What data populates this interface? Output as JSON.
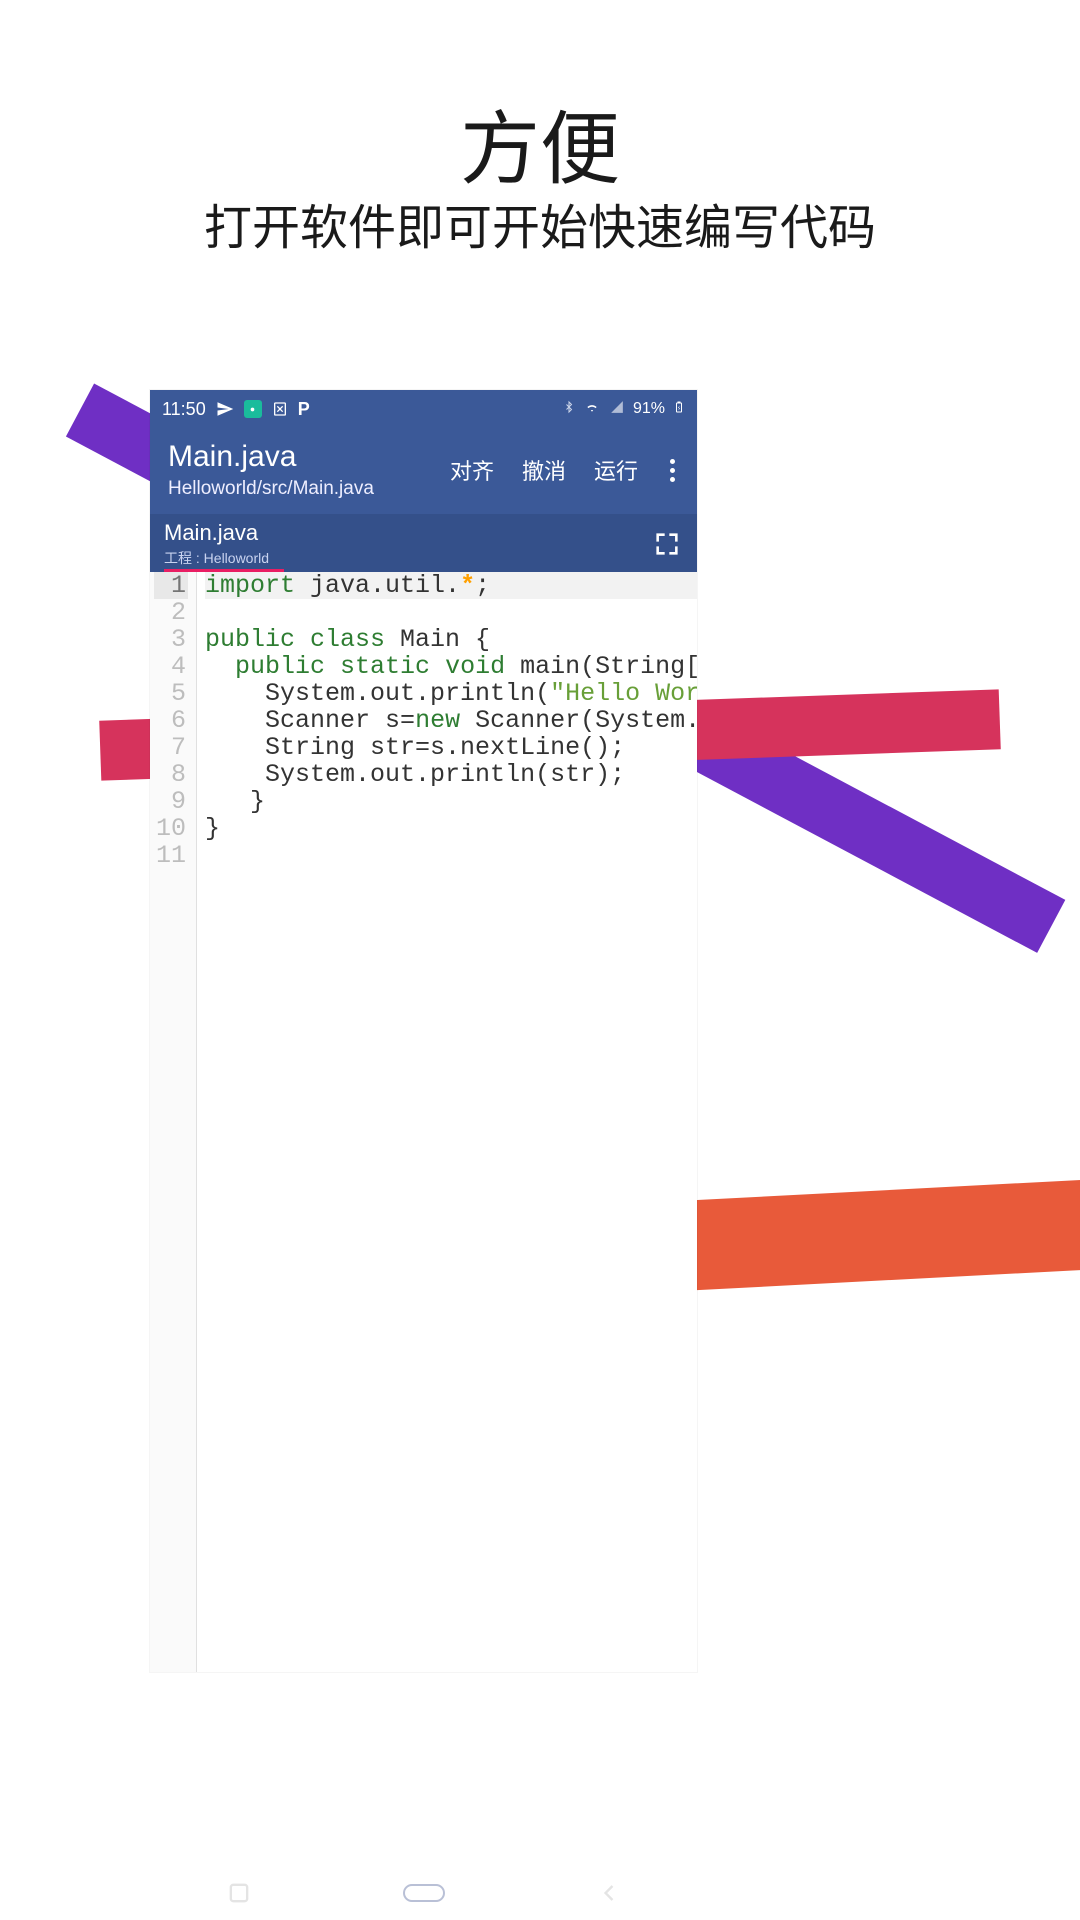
{
  "promo": {
    "headline": "方便",
    "subheadline": "打开软件即可开始快速编写代码"
  },
  "statusbar": {
    "time": "11:50",
    "battery": "91%"
  },
  "appbar": {
    "title": "Main.java",
    "subtitle": "Helloworld/src/Main.java",
    "actions": {
      "align": "对齐",
      "undo": "撤消",
      "run": "运行"
    }
  },
  "tab": {
    "name": "Main.java",
    "project_label": "工程",
    "project_name": "Helloworld"
  },
  "editor": {
    "lines": [
      {
        "n": 1,
        "tokens": [
          [
            "kw",
            "import"
          ],
          [
            "",
            " java.util."
          ],
          [
            "star",
            "*"
          ],
          [
            "",
            ";"
          ]
        ],
        "current": true
      },
      {
        "n": 2,
        "tokens": [
          [
            "",
            ""
          ]
        ]
      },
      {
        "n": 3,
        "tokens": [
          [
            "kw",
            "public class"
          ],
          [
            "",
            " Main {"
          ]
        ]
      },
      {
        "n": 4,
        "tokens": [
          [
            "",
            "  "
          ],
          [
            "kw",
            "public static void"
          ],
          [
            "",
            " main(String[]"
          ]
        ]
      },
      {
        "n": 5,
        "tokens": [
          [
            "",
            "    System.out.println("
          ],
          [
            "str",
            "\"Hello World"
          ]
        ]
      },
      {
        "n": 6,
        "tokens": [
          [
            "",
            "    Scanner s="
          ],
          [
            "kw",
            "new"
          ],
          [
            "",
            " Scanner(System.in"
          ]
        ]
      },
      {
        "n": 7,
        "tokens": [
          [
            "",
            "    String str=s.nextLine();"
          ]
        ]
      },
      {
        "n": 8,
        "tokens": [
          [
            "",
            "    System.out.println(str);"
          ]
        ]
      },
      {
        "n": 9,
        "tokens": [
          [
            "",
            "   }"
          ]
        ]
      },
      {
        "n": 10,
        "tokens": [
          [
            "",
            "}"
          ]
        ]
      },
      {
        "n": 11,
        "tokens": [
          [
            "",
            ""
          ]
        ]
      }
    ]
  }
}
